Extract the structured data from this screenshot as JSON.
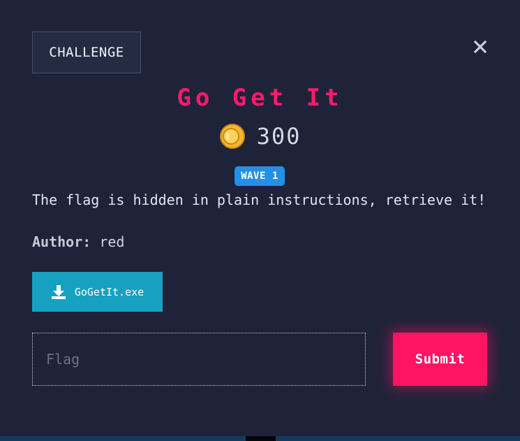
{
  "tab": {
    "label": "CHALLENGE"
  },
  "challenge": {
    "title": "Go Get It",
    "points": "300",
    "wave": "WAVE 1",
    "description": "The flag is hidden in plain instructions, retrieve it!",
    "author_label": "Author:",
    "author": "red"
  },
  "download": {
    "filename": "GoGetIt.exe",
    "icon": "download-icon"
  },
  "flag_input": {
    "placeholder": "Flag",
    "value": ""
  },
  "submit": {
    "label": "Submit"
  },
  "colors": {
    "background": "#1f2339",
    "title": "#ff1a6b",
    "badge": "#2190e8",
    "download_button": "#16a1c0",
    "submit_button": "#ff1464",
    "coin": "#f5b731"
  }
}
